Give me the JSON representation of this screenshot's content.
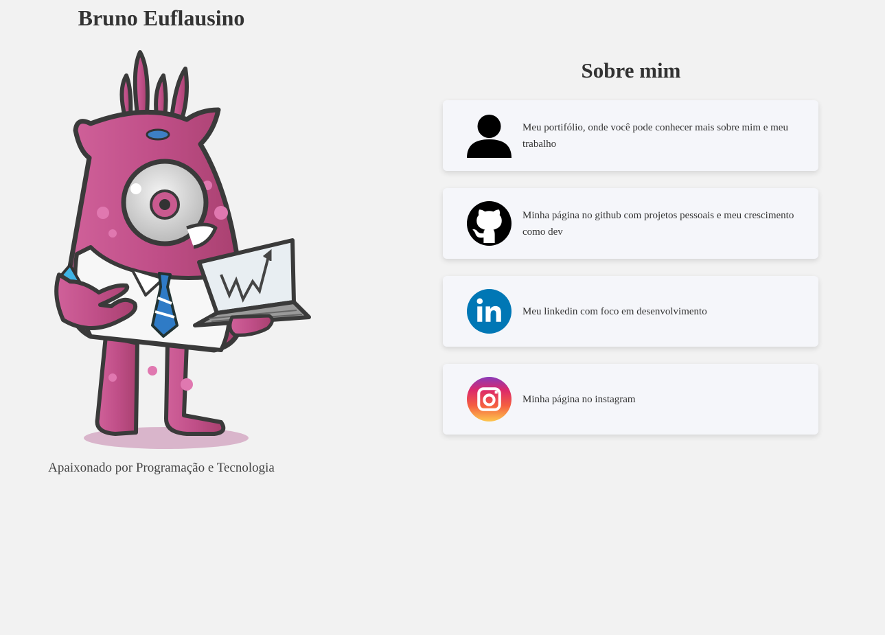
{
  "profile": {
    "name": "Bruno Euflausino",
    "tagline": "Apaixonado por Programação e Tecnologia",
    "avatar_icon": "monster-mascot-laptop-icon"
  },
  "about": {
    "title": "Sobre mim",
    "links": [
      {
        "icon": "user-icon",
        "text": "Meu portifólio, onde você pode conhecer mais sobre mim e meu trabalho"
      },
      {
        "icon": "github-icon",
        "text": "Minha página no github com projetos pessoais e meu crescimento como dev"
      },
      {
        "icon": "linkedin-icon",
        "text": "Meu linkedin com foco em desenvolvimento"
      },
      {
        "icon": "instagram-icon",
        "text": "Minha página no instagram"
      }
    ]
  },
  "colors": {
    "background": "#f2f2f2",
    "card": "#f5f6fa",
    "linkedin": "#0077b5",
    "mascot": "#c5548c"
  }
}
